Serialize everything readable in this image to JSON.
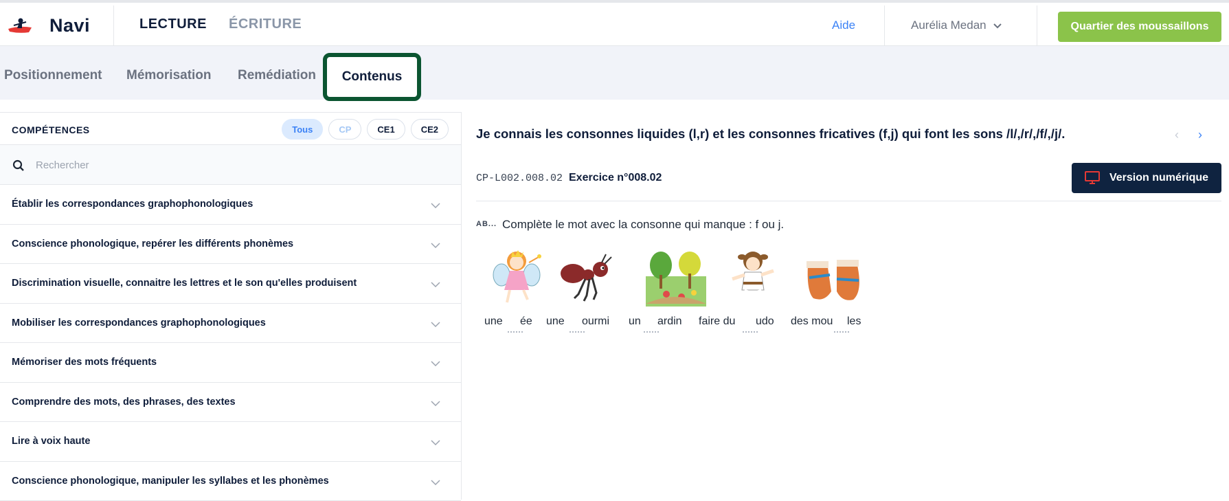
{
  "app": {
    "name": "Navi"
  },
  "topnav": {
    "tabs": [
      {
        "label": "LECTURE",
        "active": true
      },
      {
        "label": "ÉCRITURE",
        "active": false
      }
    ],
    "help": "Aide",
    "user": "Aurélia Medan",
    "cta": "Quartier des moussaillons"
  },
  "subnav": {
    "tabs": [
      "Positionnement",
      "Mémorisation",
      "Remédiation",
      "Contenus"
    ],
    "active": "Contenus"
  },
  "competences": {
    "title": "COMPÉTENCES",
    "filters": [
      "Tous",
      "CP",
      "CE1",
      "CE2"
    ],
    "active_filter": "Tous",
    "search_placeholder": "Rechercher",
    "items": [
      "Établir les correspondances graphophonologiques",
      "Conscience phonologique, repérer les différents phonèmes",
      "Discrimination visuelle, connaitre les lettres et le son qu'elles produisent",
      "Mobiliser les correspondances graphophonologiques",
      "Mémoriser des mots fréquents",
      "Comprendre des mots, des phrases, des textes",
      "Lire à voix haute",
      "Conscience phonologique, manipuler les syllabes et les phonèmes"
    ]
  },
  "content": {
    "title": "Je connais les consonnes liquides (l,r) et les consonnes fricatives (f,j) qui font les sons /l/,/r/,/f/,/j/.",
    "prev": "‹",
    "next": "›",
    "exercise_code": "CP-L002.008.02",
    "exercise_title": "Exercice n°008.02",
    "digital_button": "Version numérique",
    "instruction_icon": "AB...",
    "instruction": "Complète le mot avec la consonne qui manque : f ou j.",
    "words": [
      "une",
      "ée",
      "une",
      "ourmi",
      "un",
      "ardin",
      "faire du",
      "udo",
      "des mou",
      "les"
    ],
    "pictures": [
      "fairy",
      "ant",
      "garden",
      "judo",
      "mittens"
    ]
  },
  "colors": {
    "navy": "#0f1d3a",
    "cta_green": "#8bc34a",
    "link_blue": "#3b82f6",
    "highlight_green": "#0b5531",
    "digital_navy": "#0f2340"
  }
}
